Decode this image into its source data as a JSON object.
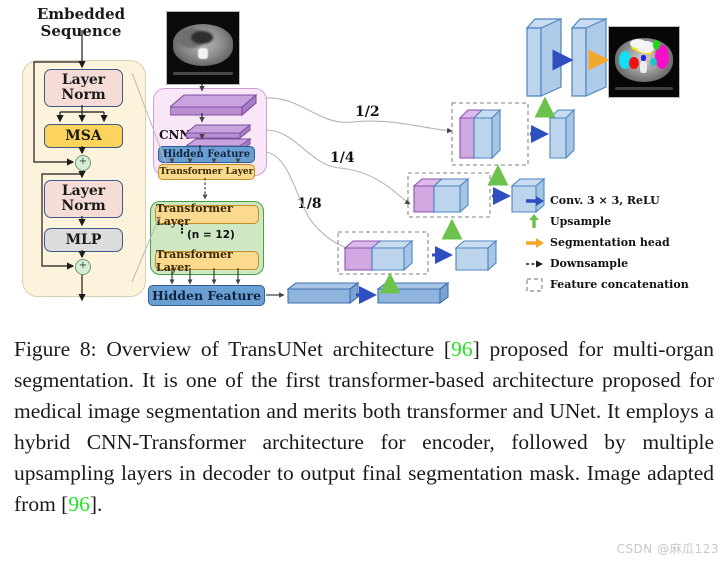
{
  "figure": {
    "embedded_sequence_label": "Embedded\nSequence",
    "transformer_detail": {
      "layer_norm_1": "Layer\nNorm",
      "msa": "MSA",
      "layer_norm_2": "Layer\nNorm",
      "mlp": "MLP",
      "residual_symbol": "+"
    },
    "encoder": {
      "cnn_label": "CNN",
      "hidden_feature_cnn": "Hidden Feature",
      "transformer_layer_cnn": "Transformer Layer",
      "transformer_layer_top": "Transformer Layer",
      "transformer_layer_bottom": "Transformer Layer",
      "repeat_count": "(n = 12)",
      "vertical_dots": "⋮",
      "hidden_feature_out": "Hidden Feature"
    },
    "skip_labels": [
      "1/2",
      "1/4",
      "1/8"
    ],
    "legend": [
      {
        "icon": "blue-right-arrow-icon",
        "label": "Conv. 3 × 3, ReLU",
        "color": "#2f4fc0"
      },
      {
        "icon": "green-up-arrow-icon",
        "label": "Upsample",
        "color": "#6cc24a"
      },
      {
        "icon": "orange-right-arrow-icon",
        "label": "Segmentation head",
        "color": "#f0a92a"
      },
      {
        "icon": "dashed-right-arrow-icon",
        "label": "Downsample",
        "color": "#1a1a1a"
      },
      {
        "icon": "dashed-box-icon",
        "label": "Feature concatenation",
        "color": "#9a9a9a"
      }
    ],
    "images": {
      "input_scan": "abdominal-ct-slice",
      "output_mask": "multi-organ-segmentation-mask"
    },
    "palette": {
      "transformer_panel": "#fdf3dc",
      "layer_norm": "#f5dcd6",
      "msa": "#fcd45c",
      "mlp": "#dcdcdc",
      "cnn_panel": "#f9e6f7",
      "cnn_slab": "#b98fd2",
      "hidden_feature": "#6a9fd4",
      "transformer_layer": "#fbd98e",
      "transformer_stack": "#cfe8c4",
      "transformer_stack_border": "#49a043",
      "decoder_blue": "#bfd8ee",
      "skip_purple": "#d9b5e6",
      "arrow_blue": "#2f4fc0",
      "arrow_green": "#6cc24a",
      "arrow_orange": "#f0a92a"
    }
  },
  "caption": {
    "prefix": "Figure 8: Overview of TransUNet architecture [",
    "ref1": "96",
    "middle": "] proposed for multi-organ segmentation. It is one of the first transformer-based architecture proposed for medical image segmentation and merits both transformer and UNet. It employs a hybrid CNN-Transformer architecture for encoder, followed by multiple upsampling layers in decoder to output final segmentation mask. Image adapted from [",
    "ref2": "96",
    "suffix": "]."
  },
  "watermark": "CSDN @麻瓜123"
}
